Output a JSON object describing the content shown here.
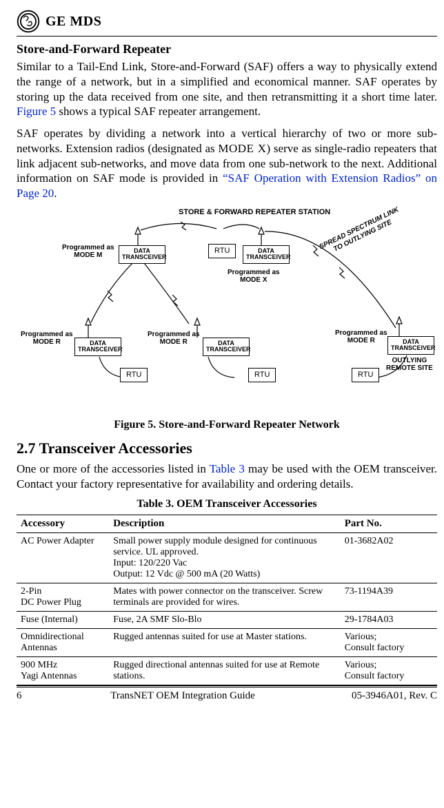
{
  "brand": "GE MDS",
  "h1": "Store-and-Forward Repeater",
  "p1_before_link": "Similar to a Tail-End Link, Store-and-Forward (SAF) offers a way to physically extend the range of a network, but in a simplified and economical manner. SAF operates by storing up the data received from one site, and then retransmitting it a short time later. ",
  "fig5_ref": "Figure 5",
  "p1_after_link": " shows a typical SAF repeater arrangement.",
  "p2_part1": "SAF operates by dividing a network into a vertical hierarchy of two or more sub-networks. Extension radios (designated as ",
  "mode_x_sc": "MODE X",
  "p2_part2": ") serve as single-radio repeaters that link adjacent sub-networks, and move data from one sub-network to the next. Additional information on SAF mode is provided in ",
  "saf_link": "“SAF Operation with Extension Radios” on Page 20",
  "p2_part3": ".",
  "diagram": {
    "title": "STORE & FORWARD REPEATER STATION",
    "spread": "SPREAD SPECTRUM LINK\nTO OUTLYING SITE",
    "dt": "DATA\nTRANSCEIVER",
    "rtu": "RTU",
    "prog_as": "Programmed as",
    "mode_m": "MODE M",
    "mode_x": "MODE X",
    "mode_r": "MODE R",
    "outlying": "OUTLYING\nREMOTE SITE"
  },
  "figure_caption": "Figure 5. Store-and-Forward Repeater Network",
  "h2": "2.7   Transceiver Accessories",
  "p3_before_link": "One or more of the accessories listed in ",
  "table_ref": "Table 3",
  "p3_after_link": " may be used with the OEM transceiver. Contact your factory representative for availability and ordering details.",
  "table_caption": "Table 3. OEM Transceiver Accessories",
  "table": {
    "head": {
      "c1": "Accessory",
      "c2": "Description",
      "c3": "Part No."
    },
    "rows": [
      {
        "c1": "AC Power Adapter",
        "c2": "Small power supply module designed for continuous service. UL approved.\nInput: 120/220 Vac\nOutput: 12 Vdc @ 500 mA (20 Watts)",
        "c3": "01-3682A02"
      },
      {
        "c1": "2-Pin\nDC Power Plug",
        "c2": "Mates with power connector on the transceiver. Screw terminals are provided for wires.",
        "c3": "73-1194A39"
      },
      {
        "c1": "Fuse (Internal)",
        "c2": "Fuse, 2A SMF Slo-Blo",
        "c3": "29-1784A03"
      },
      {
        "c1": "Omnidirectional Antennas",
        "c2": "Rugged antennas suited for use at Master stations.",
        "c3": "Various;\nConsult factory"
      },
      {
        "c1": "900 MHz\nYagi Antennas",
        "c2": "Rugged directional antennas suited for use at Remote stations.",
        "c3": "Various;\nConsult factory"
      }
    ]
  },
  "footer": {
    "pageno": "6",
    "title": "TransNET OEM Integration Guide",
    "doc": "05-3946A01, Rev. C"
  }
}
